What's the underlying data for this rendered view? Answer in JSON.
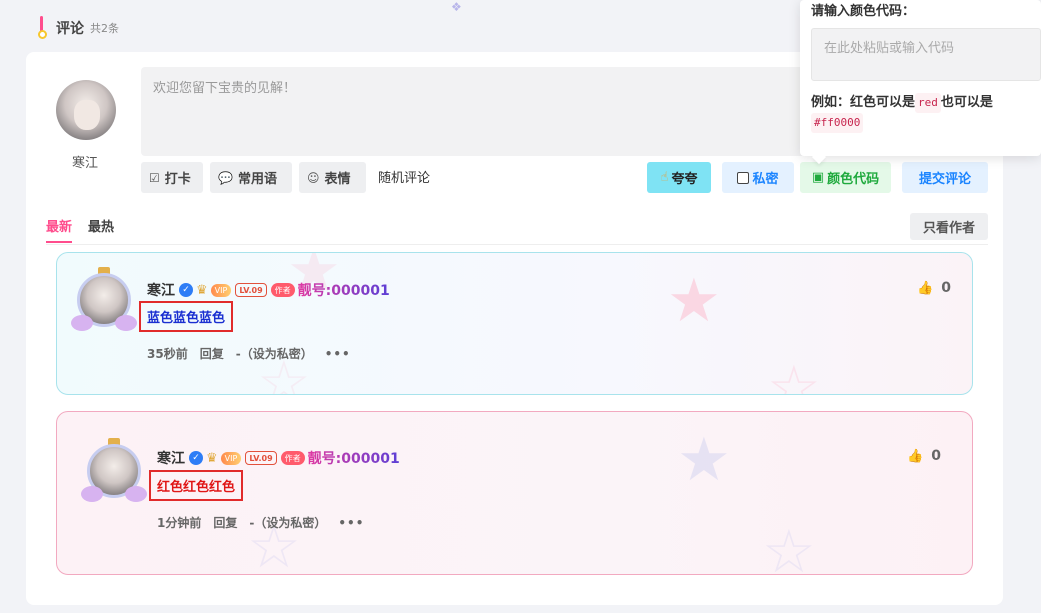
{
  "header": {
    "title": "评论",
    "count": "共2条"
  },
  "composer": {
    "user_name": "寒江",
    "placeholder": "欢迎您留下宝贵的见解！",
    "tools": [
      {
        "icon": "checkbox-icon",
        "label": "打卡"
      },
      {
        "icon": "chat-icon",
        "label": "常用语"
      },
      {
        "icon": "smile-icon",
        "label": "表情"
      }
    ],
    "random_label": "随机评论",
    "kuakua_label": "夸夸",
    "private_label": "私密",
    "color_label": "颜色代码",
    "submit_label": "提交评论"
  },
  "color_popover": {
    "title": "请输入颜色代码：",
    "input_placeholder": "在此处粘贴或输入代码",
    "example_prefix": "例如：红色可以是",
    "example_code1": "red",
    "example_mid": "也可以是",
    "example_code2": "#ff0000"
  },
  "tabs": {
    "newest": "最新",
    "hottest": "最热",
    "only_author": "只看作者"
  },
  "comments": [
    {
      "name": "寒江",
      "vip": "VIP",
      "level": "LV.09",
      "author_badge": "作者",
      "number": "靓号:000001",
      "text": "蓝色蓝色蓝色",
      "time": "35秒前",
      "reply": "回复",
      "private_action": "-（设为私密）",
      "likes": "0"
    },
    {
      "name": "寒江",
      "vip": "VIP",
      "level": "LV.09",
      "author_badge": "作者",
      "number": "靓号:000001",
      "text": "红色红色红色",
      "time": "1分钟前",
      "reply": "回复",
      "private_action": "-（设为私密）",
      "likes": "0"
    }
  ]
}
